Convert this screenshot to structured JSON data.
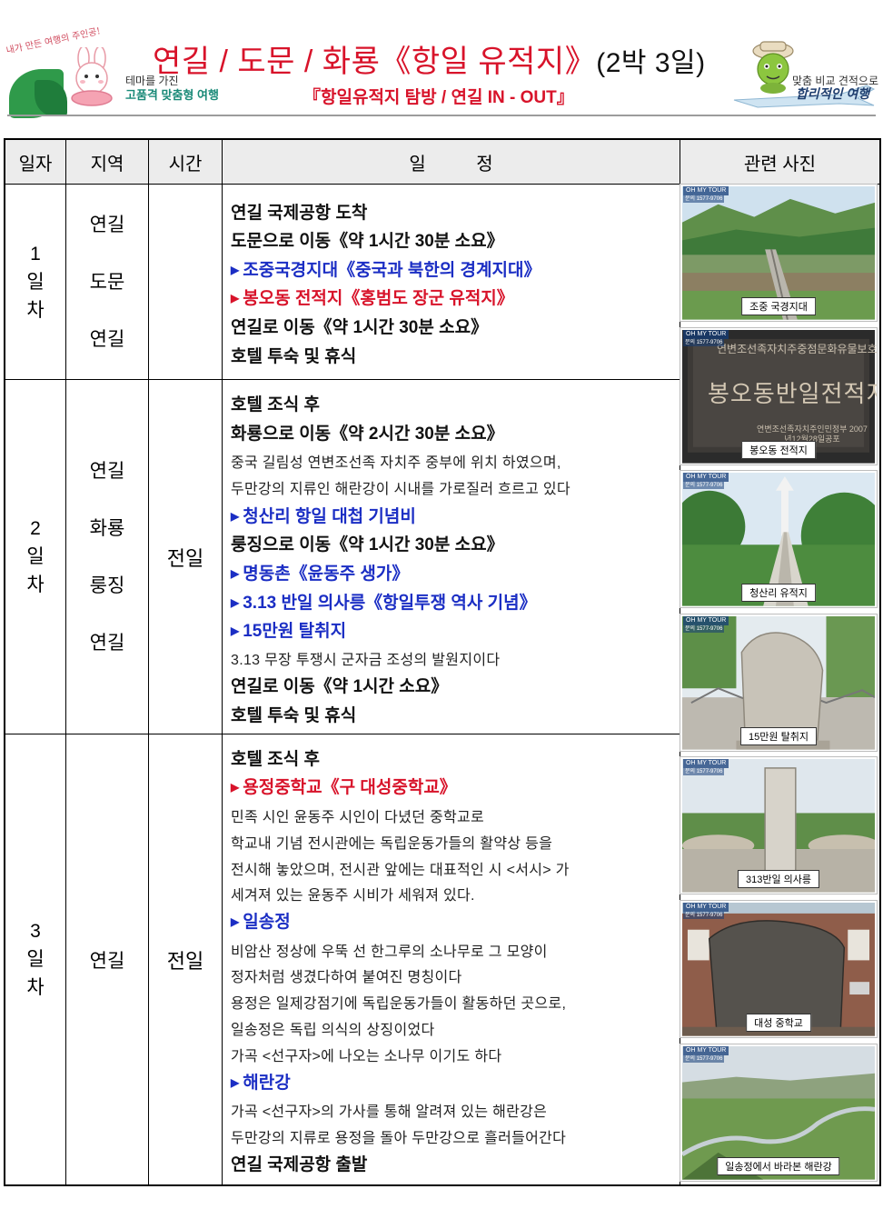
{
  "header": {
    "left_logo": {
      "slogan": "내가 만든 여행의 주인공!",
      "line1": "테마를 가진",
      "line2": "고품격 맞춤형 여행"
    },
    "title": "연길 / 도문 / 화룡《항일 유적지》",
    "title_suffix": "(2박 3일)",
    "subtitle": "『항일유적지 탐방 / 연길 IN - OUT』",
    "right_logo": {
      "line1": "맞춤 비교 견적으로",
      "line2": "합리적인 여행"
    }
  },
  "columns": {
    "day": "일자",
    "region": "지역",
    "time": "시간",
    "schedule": "일          정",
    "photos": "관련 사진"
  },
  "days": [
    {
      "day": [
        "1",
        "일",
        "차"
      ],
      "regions": [
        "연길",
        "도문",
        "연길"
      ],
      "time": "",
      "lines": [
        {
          "style": "main",
          "text": "연길 국제공항 도착"
        },
        {
          "style": "main",
          "text": "도문으로 이동《약 1시간 30분 소요》"
        },
        {
          "style": "blue",
          "text": "조중국경지대《중국과 북한의 경계지대》"
        },
        {
          "style": "red",
          "text": "봉오동 전적지《홍범도 장군 유적지》"
        },
        {
          "style": "main",
          "text": "연길로 이동《약 1시간 30분 소요》"
        },
        {
          "style": "main",
          "text": "호텔 투숙 및 휴식"
        }
      ]
    },
    {
      "day": [
        "2",
        "일",
        "차"
      ],
      "regions": [
        "연길",
        "화룡",
        "룽징",
        "연길"
      ],
      "time": "전일",
      "lines": [
        {
          "style": "main",
          "text": "호텔 조식 후"
        },
        {
          "style": "main",
          "text": "화룡으로 이동《약 2시간 30분 소요》"
        },
        {
          "style": "sub",
          "text": "중국 길림성 연변조선족 자치주 중부에 위치 하였으며,"
        },
        {
          "style": "sub",
          "text": "두만강의 지류인 해란강이 시내를 가로질러 흐르고 있다"
        },
        {
          "style": "blue",
          "text": "청산리 항일 대첩 기념비"
        },
        {
          "style": "main",
          "text": "룽징으로 이동《약 1시간 30분 소요》"
        },
        {
          "style": "blue",
          "text": "명동촌《윤동주 생가》"
        },
        {
          "style": "blue",
          "text": "3.13 반일 의사릉《항일투쟁 역사 기념》"
        },
        {
          "style": "blue",
          "text": "15만원 탈취지"
        },
        {
          "style": "sub",
          "text": "3.13 무장 투쟁시 군자금 조성의 발원지이다"
        },
        {
          "style": "main",
          "text": "연길로 이동《약 1시간 소요》"
        },
        {
          "style": "main",
          "text": "호텔 투숙 및 휴식"
        }
      ]
    },
    {
      "day": [
        "3",
        "일",
        "차"
      ],
      "regions": [
        "연길"
      ],
      "time": "전일",
      "lines": [
        {
          "style": "main",
          "text": "호텔 조식 후"
        },
        {
          "style": "red",
          "text": "용정중학교《구 대성중학교》"
        },
        {
          "style": "sub",
          "text": "민족 시인 윤동주 시인이 다녔던 중학교로"
        },
        {
          "style": "sub",
          "text": "학교내 기념 전시관에는 독립운동가들의 활약상 등을"
        },
        {
          "style": "sub",
          "text": "전시해 놓았으며, 전시관 앞에는 대표적인 시 <서시> 가"
        },
        {
          "style": "sub",
          "text": "세겨져 있는 윤동주 시비가 세워져 있다."
        },
        {
          "style": "blue",
          "text": "일송정"
        },
        {
          "style": "sub",
          "text": "비암산 정상에 우뚝 선 한그루의 소나무로 그 모양이"
        },
        {
          "style": "sub",
          "text": "정자처럼 생겼다하여 붙여진 명칭이다"
        },
        {
          "style": "sub",
          "text": "용정은 일제강점기에 독립운동가들이 활동하던 곳으로,"
        },
        {
          "style": "sub",
          "text": "일송정은 독립 의식의 상징이었다"
        },
        {
          "style": "sub",
          "text": "가곡 <선구자>에 나오는 소나무 이기도 하다"
        },
        {
          "style": "blue",
          "text": "해란강"
        },
        {
          "style": "sub",
          "text": "가곡 <선구자>의 가사를 통해 알려져 있는 해란강은"
        },
        {
          "style": "sub",
          "text": "두만강의 지류로 용정을 돌아 두만강으로 흘러들어간다"
        },
        {
          "style": "main",
          "text": "연길 국제공항 출발"
        }
      ]
    }
  ],
  "photos": {
    "brand": "OH MY TOUR",
    "phone": "문의 1577-9706",
    "items": [
      {
        "caption": "조중 국경지대"
      },
      {
        "caption": "봉오동 전적지",
        "inscription": "봉오동반일전적지",
        "plaque_top": "연변조선족자치주중점문화유물보호단위",
        "plaque_bottom": "연변조선족자치주인민정부 2007년12월28일공포"
      },
      {
        "caption": "청산리 유적지"
      },
      {
        "caption": "15만원 탈취지"
      },
      {
        "caption": "313반일 의사릉"
      },
      {
        "caption": "대성 중학교"
      },
      {
        "caption": "일송정에서 바라본 해란강"
      }
    ]
  },
  "colors": {
    "title_red": "#d8132a",
    "highlight_blue": "#1b2ec4",
    "header_gray": "#ececec"
  }
}
